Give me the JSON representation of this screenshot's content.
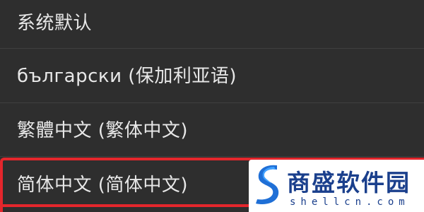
{
  "language_list": {
    "items": [
      {
        "label": "系统默认"
      },
      {
        "label": "български (保加利亚语)"
      },
      {
        "label": "繁體中文 (繁体中文)"
      },
      {
        "label": "简体中文 (简体中文)"
      }
    ],
    "highlighted_index": 3
  },
  "colors": {
    "background": "#2e2e2e",
    "text": "#e8e8e8",
    "divider": "#3f3f3f",
    "highlight": "#e4262c",
    "watermark_brand": "#1a3f8c"
  },
  "watermark": {
    "brand": "商盛软件园",
    "domain": "shellcn.com",
    "icon": "s-logo-icon"
  }
}
